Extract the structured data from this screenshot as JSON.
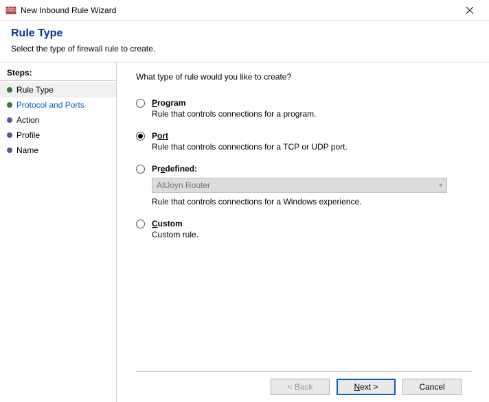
{
  "window": {
    "title": "New Inbound Rule Wizard"
  },
  "header": {
    "title": "Rule Type",
    "subtitle": "Select the type of firewall rule to create."
  },
  "sidebar": {
    "title": "Steps:",
    "items": [
      {
        "label": "Rule Type"
      },
      {
        "label": "Protocol and Ports"
      },
      {
        "label": "Action"
      },
      {
        "label": "Profile"
      },
      {
        "label": "Name"
      }
    ]
  },
  "content": {
    "prompt": "What type of rule would you like to create?",
    "options": {
      "program": {
        "label_prefix": "P",
        "label_rest": "rogram",
        "desc": "Rule that controls connections for a program."
      },
      "port": {
        "label_prefix": "P",
        "label_rest": "ort",
        "desc": "Rule that controls connections for a TCP or UDP port."
      },
      "predefined": {
        "label_prefix": "Pr",
        "label_rest_u": "e",
        "label_rest2": "defined:",
        "dropdown_value": "AllJoyn Router",
        "desc": "Rule that controls connections for a Windows experience."
      },
      "custom": {
        "label_prefix": "C",
        "label_rest": "ustom",
        "desc": "Custom rule."
      }
    },
    "selected": "port"
  },
  "footer": {
    "back": "< Back",
    "next_prefix": "N",
    "next_rest": "ext >",
    "cancel": "Cancel"
  }
}
